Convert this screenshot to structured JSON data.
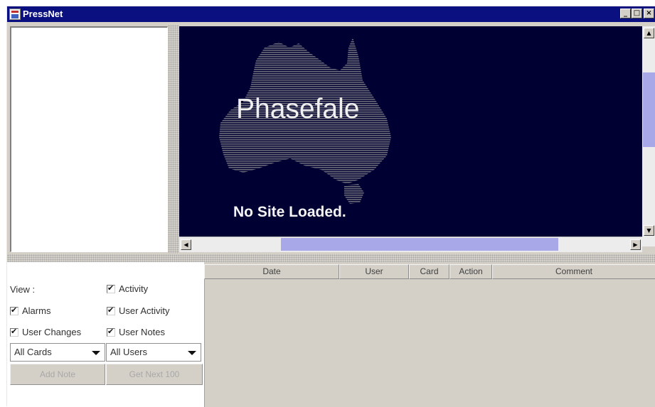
{
  "window": {
    "title": "PressNet",
    "controls": {
      "minimize": "_",
      "maximize": "□",
      "close": "×"
    }
  },
  "map": {
    "title": "Phasefale",
    "status": "No Site Loaded.",
    "background_color": "#000033",
    "shape": "australia-map"
  },
  "scrollbars": {
    "up_arrow": "▲",
    "down_arrow": "▼",
    "left_arrow": "◀",
    "right_arrow": "▶",
    "thumb_color": "#a8a8e8"
  },
  "filters": {
    "view_label": "View :",
    "checkboxes": [
      {
        "label": "Activity",
        "checked": true
      },
      {
        "label": "Alarms",
        "checked": true
      },
      {
        "label": "User Activity",
        "checked": true
      },
      {
        "label": "User Changes",
        "checked": true
      },
      {
        "label": "User Notes",
        "checked": true
      }
    ],
    "check_glyph": "✔",
    "cards_select": "All Cards",
    "users_select": "All Users"
  },
  "buttons": {
    "add_note": "Add Note",
    "get_next": "Get Next 100"
  },
  "table": {
    "columns": [
      "Date",
      "User",
      "Card",
      "Action",
      "Comment"
    ],
    "rows": []
  }
}
